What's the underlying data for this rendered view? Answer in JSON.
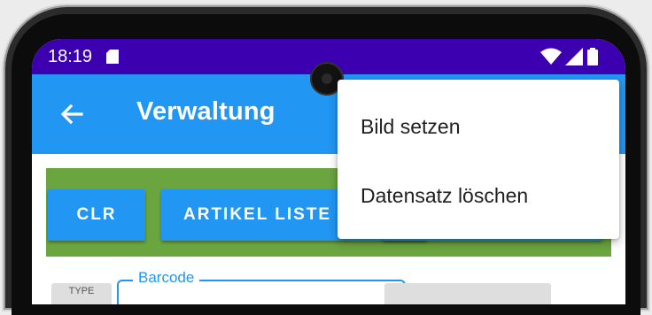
{
  "status_bar": {
    "time": "18:19",
    "icons": [
      "sd-card-icon",
      "wifi-icon",
      "signal-icon",
      "battery-icon"
    ]
  },
  "app_bar": {
    "title": "Verwaltung",
    "back_icon": "arrow-left-icon"
  },
  "toolbar": {
    "clr_label": "CLR",
    "artikel_label": "ARTIKEL LISTE"
  },
  "form": {
    "barcode_label": "Barcode",
    "left_chip_text": "TYPE"
  },
  "overflow_menu": {
    "items": [
      {
        "label": "Bild setzen"
      },
      {
        "label": "Datensatz löschen"
      }
    ]
  },
  "colors": {
    "status_bar": "#3c00b0",
    "app_bar": "#2196f3",
    "button": "#2196f3",
    "green_band": "#6aa53f"
  }
}
